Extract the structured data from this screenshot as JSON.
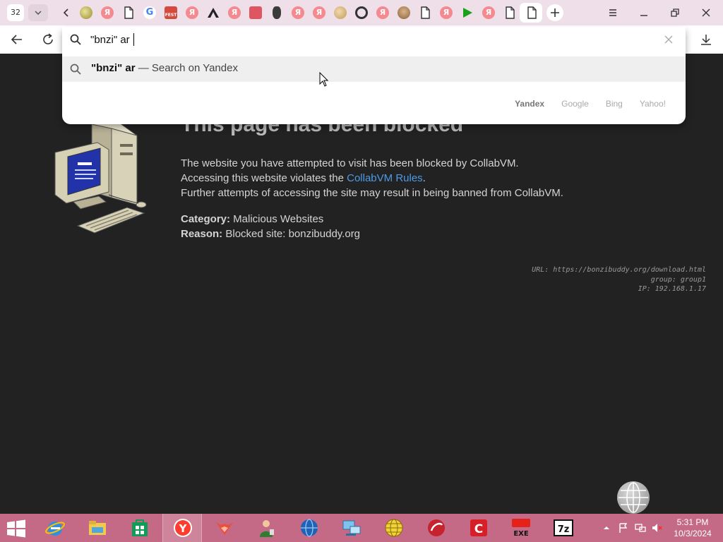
{
  "tabstrip": {
    "tab_count": "32",
    "tabs": [
      {
        "icon": "bonzi-icon"
      },
      {
        "icon": "yandex-icon",
        "letter": "Я"
      },
      {
        "icon": "page-icon"
      },
      {
        "icon": "google-icon",
        "letter": "G"
      },
      {
        "icon": "fest-icon",
        "letter": "FEST"
      },
      {
        "icon": "yandex-icon",
        "letter": "Я"
      },
      {
        "icon": "delta-icon"
      },
      {
        "icon": "yandex-icon",
        "letter": "Я"
      },
      {
        "icon": "mail-icon"
      },
      {
        "icon": "ninja-icon"
      },
      {
        "icon": "yandex-icon",
        "letter": "Я"
      },
      {
        "icon": "yandex-icon",
        "letter": "Я"
      },
      {
        "icon": "cookie-icon"
      },
      {
        "icon": "ring-icon"
      },
      {
        "icon": "yandex-icon",
        "letter": "Я"
      },
      {
        "icon": "cake-icon"
      },
      {
        "icon": "page-icon"
      },
      {
        "icon": "yandex-icon",
        "letter": "Я"
      },
      {
        "icon": "play-icon"
      },
      {
        "icon": "yandex-icon",
        "letter": "Я"
      },
      {
        "icon": "page-icon"
      },
      {
        "icon": "page-icon",
        "active": true
      }
    ]
  },
  "omnibox": {
    "value": "\"bnzi\" ar",
    "suggestion_query": "\"bnzi\" ar",
    "suggestion_hint": " — Search on Yandex",
    "engines": [
      "Yandex",
      "Google",
      "Bing",
      "Yahoo!"
    ],
    "current_engine": "Yandex"
  },
  "page": {
    "title": "This page has been blocked",
    "line1": "The website you have attempted to visit has been blocked by CollabVM.",
    "line2_prefix": "Accessing this website violates the ",
    "line2_link": "CollabVM Rules",
    "line2_suffix": ".",
    "line3": "Further attempts of accessing the site may result in being banned from CollabVM.",
    "category_label": "Category:",
    "category_value": " Malicious Websites",
    "reason_label": "Reason:",
    "reason_value": " Blocked site: bonzibuddy.org",
    "debug": {
      "url": "URL: https://bonzibuddy.org/download.html",
      "group": "group: group1",
      "ip": "IP: 192.168.1.17"
    }
  },
  "taskbar": {
    "apps": [
      "internet-explorer-icon",
      "file-explorer-icon",
      "store-icon",
      "yandex-browser-icon",
      "fox-icon",
      "agent-icon",
      "globe-icon",
      "network-icon",
      "browser-globe-icon",
      "app-red-icon",
      "c-app-icon",
      "youtube-exe-icon",
      "7zip-icon"
    ],
    "exe_label": "EXE",
    "zip_label": "7z",
    "time": "5:31 PM",
    "date": "10/3/2024"
  },
  "colors": {
    "tabstrip_bg": "#eedfe8",
    "page_bg": "#222222",
    "link": "#4c9be8",
    "taskbar_bg": "#c46a86"
  }
}
